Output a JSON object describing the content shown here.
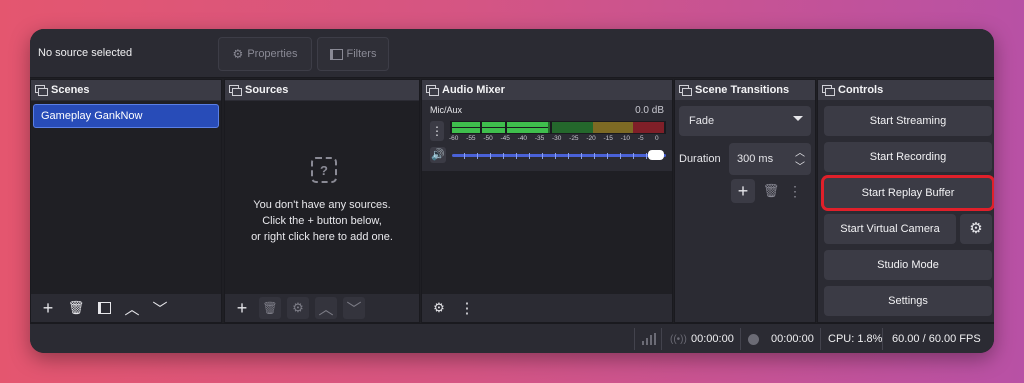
{
  "topbar": {
    "no_source": "No source selected",
    "properties_label": "Properties",
    "filters_label": "Filters"
  },
  "scenes": {
    "title": "Scenes",
    "items": [
      "Gameplay GankNow"
    ]
  },
  "sources": {
    "title": "Sources",
    "empty_lines": [
      "You don't have any sources.",
      "Click the + button below,",
      "or right click here to add one."
    ]
  },
  "audio_mixer": {
    "title": "Audio Mixer",
    "channel_name": "Mic/Aux",
    "level": "0.0 dB",
    "ticks": [
      "-60",
      "-55",
      "-50",
      "-45",
      "-40",
      "-35",
      "-30",
      "-25",
      "-20",
      "-15",
      "-10",
      "-5",
      "0"
    ]
  },
  "transitions": {
    "title": "Scene Transitions",
    "selected": "Fade",
    "duration_label": "Duration",
    "duration_value": "300 ms"
  },
  "controls": {
    "title": "Controls",
    "start_streaming": "Start Streaming",
    "start_recording": "Start Recording",
    "start_replay_buffer": "Start Replay Buffer",
    "start_virtual_camera": "Start Virtual Camera",
    "studio_mode": "Studio Mode",
    "settings": "Settings"
  },
  "statusbar": {
    "stream_time": "00:00:00",
    "record_time": "00:00:00",
    "cpu": "CPU: 1.8%",
    "fps": "60.00 / 60.00 FPS"
  },
  "colors": {
    "highlight_ring": "#e0202a",
    "selected_scene": "#284cb8",
    "meter_green": "#3fbf4d",
    "meter_yellow": "#a58a2c",
    "meter_red": "#9c2630",
    "volume_slider": "#4a62d8"
  }
}
